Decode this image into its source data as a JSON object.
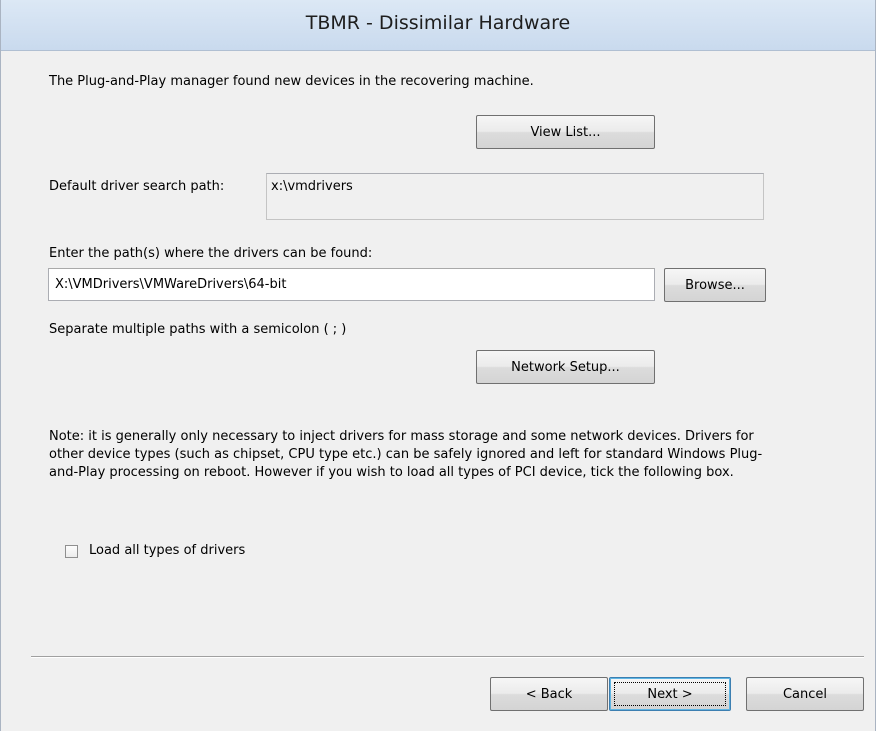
{
  "window": {
    "title": "TBMR - Dissimilar Hardware"
  },
  "intro_text": "The Plug-and-Play manager found new devices in the recovering machine.",
  "view_list_button": "View List...",
  "default_path": {
    "label": "Default driver search path:",
    "value": "x:\\vmdrivers"
  },
  "enter_path": {
    "label": "Enter the path(s) where the drivers can be found:",
    "value": "X:\\VMDrivers\\VMWareDrivers\\64-bit",
    "browse_label": "Browse..."
  },
  "separator_hint": "Separate multiple paths with a semicolon ( ; )",
  "network_setup_button": "Network Setup...",
  "note_text": "Note: it is generally only necessary to inject drivers for mass storage and some network devices. Drivers for other device types (such as chipset, CPU type etc.) can be safely ignored and left for standard Windows Plug-and-Play processing on reboot. However if you wish to load all types of PCI device, tick the following box.",
  "load_all_checkbox": {
    "label": "Load all types of drivers",
    "checked": false
  },
  "footer": {
    "back_label": "< Back",
    "next_label": "Next >",
    "cancel_label": "Cancel"
  }
}
